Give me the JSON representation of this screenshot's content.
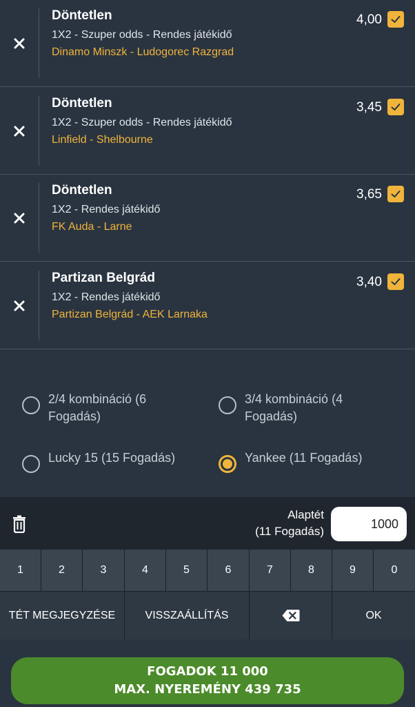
{
  "bets": [
    {
      "selection": "Döntetlen",
      "market": "1X2 - Szuper odds - Rendes játékidő",
      "match": "Dinamo Minszk - Ludogorec Razgrad",
      "odds": "4,00",
      "checked": true
    },
    {
      "selection": "Döntetlen",
      "market": "1X2 - Szuper odds - Rendes játékidő",
      "match": "Linfield - Shelbourne",
      "odds": "3,45",
      "checked": true
    },
    {
      "selection": "Döntetlen",
      "market": "1X2 - Rendes játékidő",
      "match": "FK Auda - Larne",
      "odds": "3,65",
      "checked": true
    },
    {
      "selection": "Partizan Belgrád",
      "market": "1X2 - Rendes játékidő",
      "match": "Partizan Belgrád - AEK Larnaka",
      "odds": "3,40",
      "checked": true
    }
  ],
  "systems": [
    {
      "label": "2/4 kombináció (6 Fogadás)",
      "selected": false
    },
    {
      "label": "3/4 kombináció (4 Fogadás)",
      "selected": false
    },
    {
      "label": "Lucky 15 (15 Fogadás)",
      "selected": false
    },
    {
      "label": "Yankee (11 Fogadás)",
      "selected": true
    }
  ],
  "stake": {
    "label_line1": "Alaptét",
    "label_line2": "(11 Fogadás)",
    "value": "1000"
  },
  "keypad": {
    "digits": [
      "1",
      "2",
      "3",
      "4",
      "5",
      "6",
      "7",
      "8",
      "9",
      "0"
    ],
    "note_label": "TÉT MEGJEGYZÉSE",
    "reset_label": "VISSZAÁLLÍTÁS",
    "ok_label": "OK"
  },
  "place_bet": {
    "line1": "FOGADOK  11 000",
    "line2": "MAX. NYEREMÉNY 439 735"
  },
  "colors": {
    "accent": "#f0b43c",
    "background": "#2a3440",
    "cta": "#4c8b2b"
  },
  "icons": {
    "remove": "close-icon",
    "check": "checkbox-checked-icon",
    "trash": "trash-icon",
    "backspace": "backspace-icon"
  }
}
